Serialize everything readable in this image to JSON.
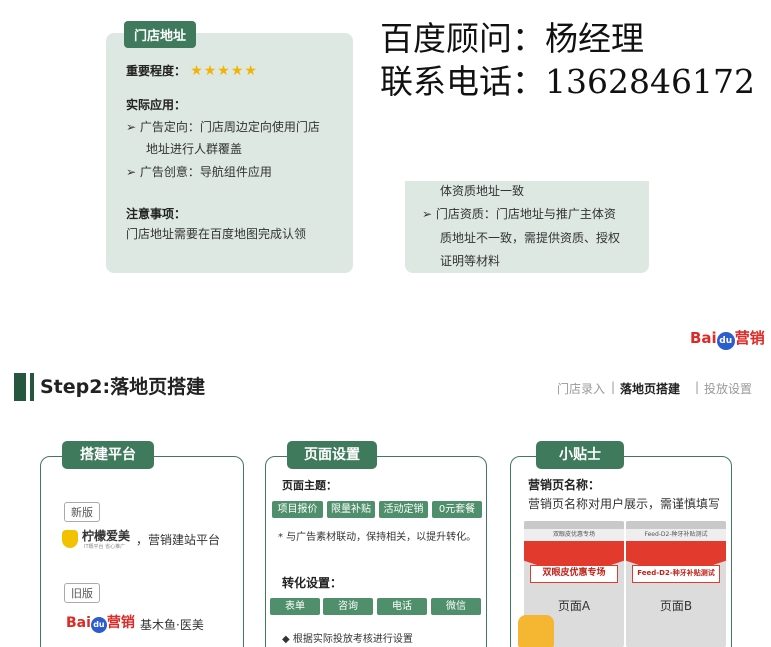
{
  "top_card": {
    "tag": "门店地址",
    "importance_label": "重要程度：",
    "stars": "★★★★★",
    "usage_label": "实际应用：",
    "usage_1a": "➢  广告定向：门店周边定向使用门店",
    "usage_1b": "地址进行人群覆盖",
    "usage_2": "➢  广告创意：导航组件应用",
    "notes_label": "注意事项：",
    "notes_text": "门店地址需要在百度地图完成认领"
  },
  "right_card": {
    "line1": "体资质地址一致",
    "line2": "➢  门店资质：门店地址与推广主体资",
    "line3": "质地址不一致，需提供资质、授权",
    "line4": "证明等材料"
  },
  "overlay": {
    "line1": "百度顾问：杨经理",
    "line2": "联系电话：1362846172"
  },
  "logo": {
    "bai": "Bai",
    "paw": "du",
    "ying": "营销"
  },
  "step": {
    "title": "Step2:落地页搭建",
    "crumb_1": "门店录入",
    "sep_1": "|",
    "crumb_2": "落地页搭建",
    "sep_2": "|",
    "crumb_3": "投放设置"
  },
  "platform": {
    "header": "搭建平台",
    "new_tag": "新版",
    "lemon_name": "柠檬爱美",
    "lemon_sub": "IT概平台 省心推广",
    "lemon_desc": "，营销建站平台",
    "old_tag": "旧版",
    "old_desc": "基木鱼·医美"
  },
  "page_settings": {
    "header": "页面设置",
    "theme_label": "页面主题：",
    "chips": [
      "项目报价",
      "限量补贴",
      "活动定销",
      "0元套餐"
    ],
    "theme_note": "* 与广告素材联动，保持相关，以提升转化。",
    "conv_label": "转化设置：",
    "conv_chips": [
      "表单",
      "咨询",
      "电话",
      "微信"
    ],
    "conv_note": "◆ 根据实际投放考核进行设置"
  },
  "tips": {
    "header": "小贴士",
    "name_label": "营销页名称：",
    "name_desc": "营销页名称对用户展示，需谨慎填写",
    "phoneA_title": "双眼皮优惠专场",
    "phoneA_label": "双眼皮优惠专场",
    "phoneA_name": "页面A",
    "phoneB_title": "Feed-D2-种牙补贴测试",
    "phoneB_label": "Feed-D2-种牙补贴测试",
    "phoneB_name": "页面B"
  },
  "colors": {
    "accent": "#3f7a5d",
    "card_bg": "#dde8e3",
    "star": "#f1b400",
    "baidu_red": "#de2a25",
    "baidu_blue": "#2d5ccf",
    "phone_red": "#e23b2e"
  }
}
